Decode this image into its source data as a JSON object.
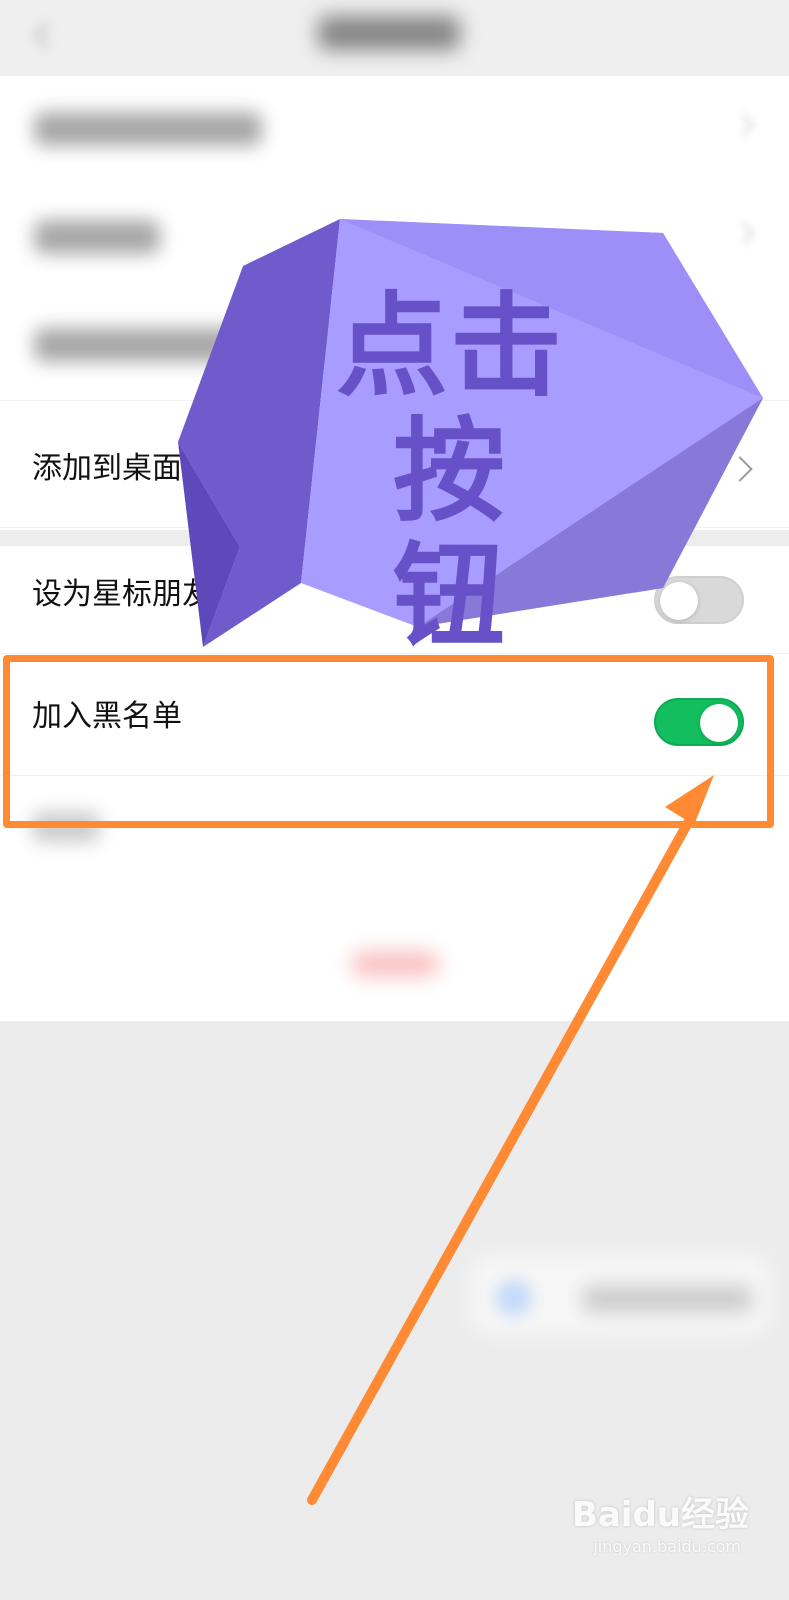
{
  "screen": {
    "rows": [
      {
        "label": "添加到桌面",
        "type": "chevron"
      },
      {
        "label": "设为星标朋友",
        "type": "toggle",
        "state": false
      },
      {
        "label": "加入黑名单",
        "type": "toggle",
        "state": true
      }
    ]
  },
  "annotation": {
    "bubble_text": "点击按\n钮"
  },
  "watermark": {
    "text": "Baidu经验",
    "subtext": "jingyan.baidu.com"
  },
  "colors": {
    "highlight": "#ff8a33",
    "toggle_on": "#12be5e",
    "bubble_fill": "#a99cff",
    "bubble_text": "#6751c8"
  }
}
